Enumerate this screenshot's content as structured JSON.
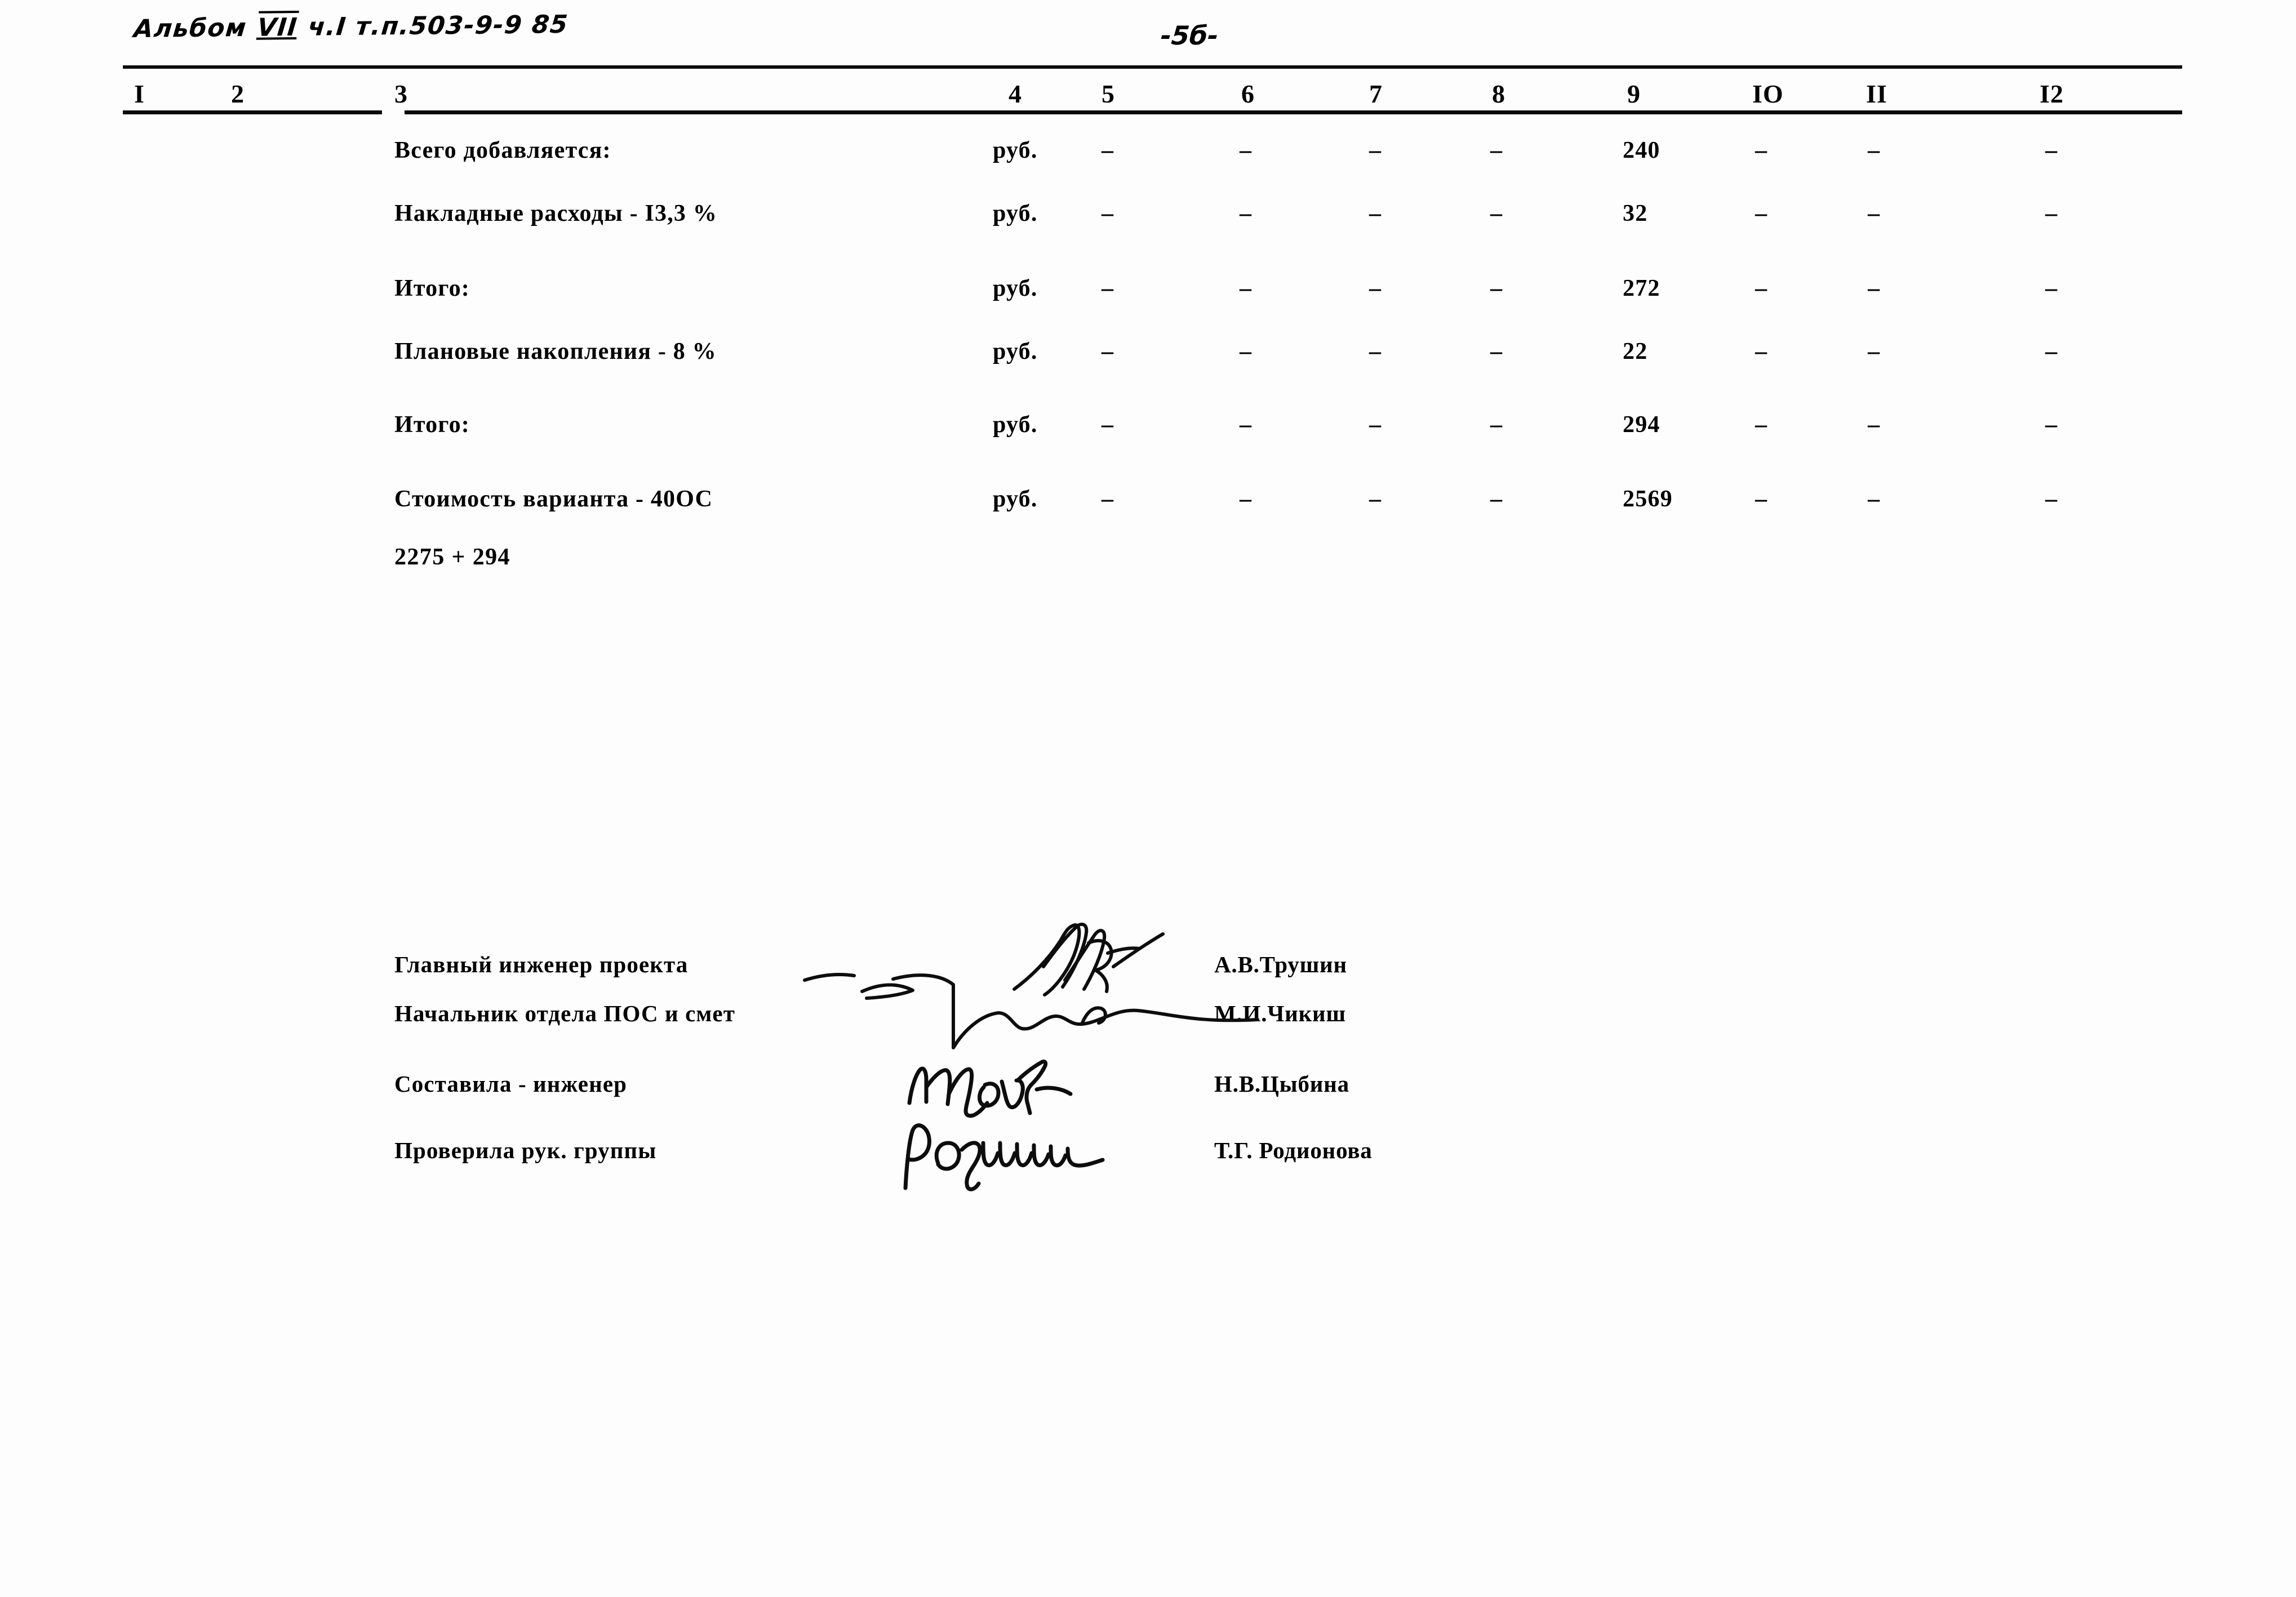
{
  "header": {
    "album_note_prefix": "Альбом ",
    "album_roman": "VII",
    "album_note_suffix": " ч.I  т.п.503-9-9 85",
    "page_number": "-5б-"
  },
  "table": {
    "column_numbers": [
      "I",
      "2",
      "3",
      "4",
      "5",
      "6",
      "7",
      "8",
      "9",
      "IО",
      "II",
      "I2"
    ],
    "rows": [
      {
        "label": "Всего добавляется:",
        "unit": "руб.",
        "c5": "–",
        "c6": "–",
        "c7": "–",
        "c8": "–",
        "c9": "240",
        "c10": "–",
        "c11": "–",
        "c12": "–"
      },
      {
        "label": "Накладные расходы - I3,3 %",
        "unit": "руб.",
        "c5": "–",
        "c6": "–",
        "c7": "–",
        "c8": "–",
        "c9": "32",
        "c10": "–",
        "c11": "–",
        "c12": "–"
      },
      {
        "label": "Итого:",
        "unit": "руб.",
        "c5": "–",
        "c6": "–",
        "c7": "–",
        "c8": "–",
        "c9": "272",
        "c10": "–",
        "c11": "–",
        "c12": "–"
      },
      {
        "label": "Плановые накопления - 8 %",
        "unit": "руб.",
        "c5": "–",
        "c6": "–",
        "c7": "–",
        "c8": "–",
        "c9": "22",
        "c10": "–",
        "c11": "–",
        "c12": "–"
      },
      {
        "label": "Итого:",
        "unit": "руб.",
        "c5": "–",
        "c6": "–",
        "c7": "–",
        "c8": "–",
        "c9": "294",
        "c10": "–",
        "c11": "–",
        "c12": "–"
      },
      {
        "label": "Стоимость варианта - 40ОС",
        "unit": "руб.",
        "c5": "–",
        "c6": "–",
        "c7": "–",
        "c8": "–",
        "c9": "2569",
        "c10": "–",
        "c11": "–",
        "c12": "–"
      }
    ],
    "formula": "2275 + 294"
  },
  "signatures": [
    {
      "role": "Главный инженер проекта",
      "name": "А.В.Трушин"
    },
    {
      "role": "Начальник отдела ПОС и смет",
      "name": "М.И.Чикиш"
    },
    {
      "role": "Составила - инженер",
      "name": "Н.В.Цыбина"
    },
    {
      "role": "Проверила рук. группы",
      "name": "Т.Г. Родионова"
    }
  ],
  "ink": {
    "signature_upper": "Ꮥ",
    "signature_cybina": "Нцыбф",
    "signature_rodionova": "Родиииии"
  }
}
